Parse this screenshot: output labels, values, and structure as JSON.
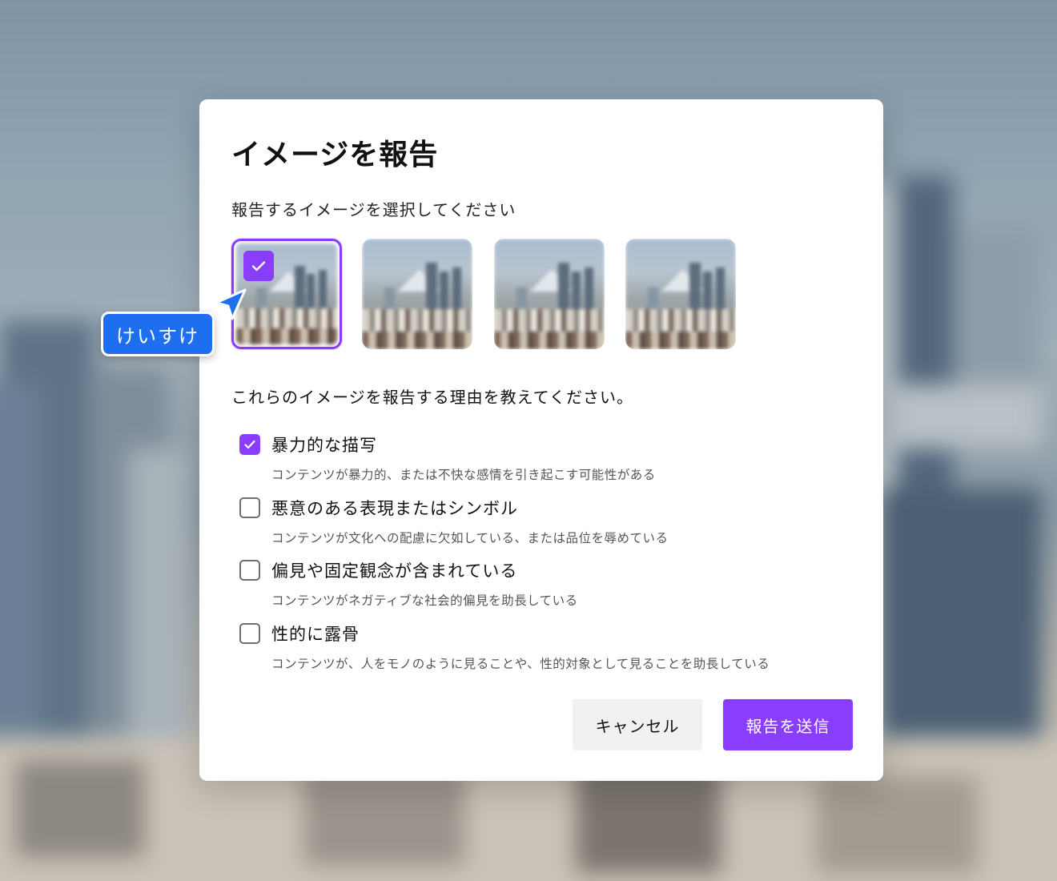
{
  "dialog": {
    "title": "イメージを報告",
    "select_prompt": "報告するイメージを選択してください",
    "images": [
      {
        "selected": true
      },
      {
        "selected": false
      },
      {
        "selected": false
      },
      {
        "selected": false
      }
    ],
    "reason_prompt": "これらのイメージを報告する理由を教えてください。",
    "options": [
      {
        "label": "暴力的な描写",
        "description": "コンテンツが暴力的、または不快な感情を引き起こす可能性がある",
        "checked": true
      },
      {
        "label": "悪意のある表現またはシンボル",
        "description": "コンテンツが文化への配慮に欠如している、または品位を辱めている",
        "checked": false
      },
      {
        "label": "偏見や固定観念が含まれている",
        "description": "コンテンツがネガティブな社会的偏見を助長している",
        "checked": false
      },
      {
        "label": "性的に露骨",
        "description": "コンテンツが、人をモノのように見ることや、性的対象として見ることを助長している",
        "checked": false
      }
    ],
    "cancel_label": "キャンセル",
    "submit_label": "報告を送信"
  },
  "collaborator": {
    "name": "けいすけ",
    "color": "#1e6ff0"
  },
  "colors": {
    "accent": "#8b3dff",
    "cancel_bg": "#f0f1f3"
  }
}
